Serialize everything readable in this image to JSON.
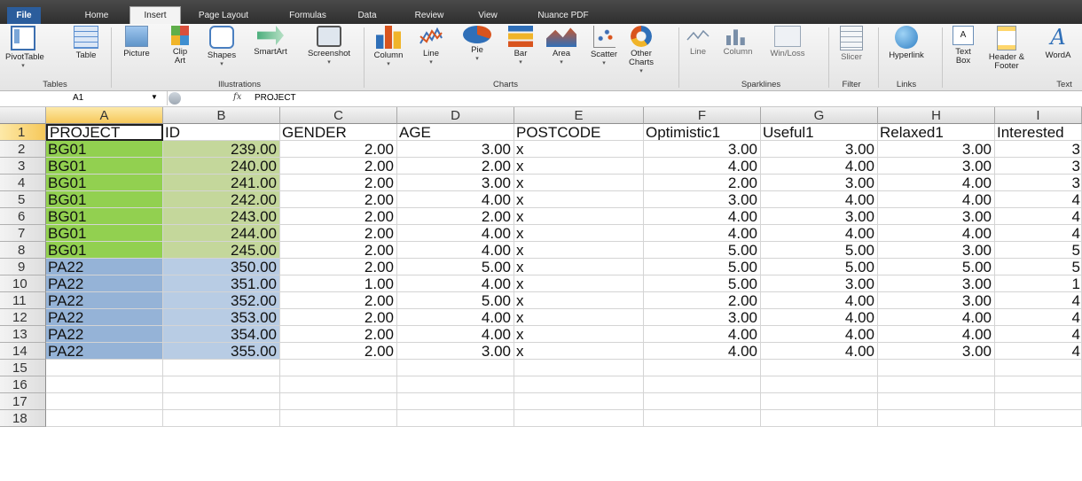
{
  "tabs": [
    "File",
    "Home",
    "Insert",
    "Page Layout",
    "Formulas",
    "Data",
    "Review",
    "View",
    "Nuance PDF"
  ],
  "active_tab": "Insert",
  "ribbon": {
    "tables": {
      "label": "Tables",
      "pivot": "PivotTable",
      "table": "Table"
    },
    "illustrations": {
      "label": "Illustrations",
      "picture": "Picture",
      "clipart": "Clip Art",
      "shapes": "Shapes",
      "smartart": "SmartArt",
      "screenshot": "Screenshot"
    },
    "charts": {
      "label": "Charts",
      "column": "Column",
      "line": "Line",
      "pie": "Pie",
      "bar": "Bar",
      "area": "Area",
      "scatter": "Scatter",
      "other": "Other Charts"
    },
    "sparklines": {
      "label": "Sparklines",
      "line": "Line",
      "column": "Column",
      "winloss": "Win/Loss"
    },
    "filter": {
      "label": "Filter",
      "slicer": "Slicer"
    },
    "links": {
      "label": "Links",
      "hyperlink": "Hyperlink"
    },
    "text": {
      "label": "Text",
      "textbox": "Text Box",
      "header": "Header & Footer",
      "wordart": "WordA"
    }
  },
  "formula_bar": {
    "name_box": "A1",
    "fx": "fx",
    "content": "PROJECT"
  },
  "columns": [
    "A",
    "B",
    "C",
    "D",
    "E",
    "F",
    "G",
    "H",
    "I"
  ],
  "rows": [
    [
      "PROJECT",
      "ID",
      "GENDER",
      "AGE",
      "POSTCODE",
      "Optimistic1",
      "Useful1",
      "Relaxed1",
      "Interested"
    ],
    [
      "BG01",
      "239.00",
      "2.00",
      "3.00",
      "x",
      "3.00",
      "3.00",
      "3.00",
      "3"
    ],
    [
      "BG01",
      "240.00",
      "2.00",
      "2.00",
      "x",
      "4.00",
      "4.00",
      "3.00",
      "3"
    ],
    [
      "BG01",
      "241.00",
      "2.00",
      "3.00",
      "x",
      "2.00",
      "3.00",
      "4.00",
      "3"
    ],
    [
      "BG01",
      "242.00",
      "2.00",
      "4.00",
      "x",
      "3.00",
      "4.00",
      "4.00",
      "4"
    ],
    [
      "BG01",
      "243.00",
      "2.00",
      "2.00",
      "x",
      "4.00",
      "3.00",
      "3.00",
      "4"
    ],
    [
      "BG01",
      "244.00",
      "2.00",
      "4.00",
      "x",
      "4.00",
      "4.00",
      "4.00",
      "4"
    ],
    [
      "BG01",
      "245.00",
      "2.00",
      "4.00",
      "x",
      "5.00",
      "5.00",
      "3.00",
      "5"
    ],
    [
      "PA22",
      "350.00",
      "2.00",
      "5.00",
      "x",
      "5.00",
      "5.00",
      "5.00",
      "5"
    ],
    [
      "PA22",
      "351.00",
      "1.00",
      "4.00",
      "x",
      "5.00",
      "3.00",
      "3.00",
      "1"
    ],
    [
      "PA22",
      "352.00",
      "2.00",
      "5.00",
      "x",
      "2.00",
      "4.00",
      "3.00",
      "4"
    ],
    [
      "PA22",
      "353.00",
      "2.00",
      "4.00",
      "x",
      "3.00",
      "4.00",
      "4.00",
      "4"
    ],
    [
      "PA22",
      "354.00",
      "2.00",
      "4.00",
      "x",
      "4.00",
      "4.00",
      "4.00",
      "4"
    ],
    [
      "PA22",
      "355.00",
      "2.00",
      "3.00",
      "x",
      "4.00",
      "4.00",
      "3.00",
      "4"
    ]
  ],
  "row_numbers": [
    "1",
    "2",
    "3",
    "4",
    "5",
    "6",
    "7",
    "8",
    "9",
    "10",
    "11",
    "12",
    "13",
    "14",
    "15",
    "16",
    "17",
    "18"
  ],
  "colors": {
    "green_a": "#92d050",
    "green_b": "#c4d79b",
    "blue_a": "#95b3d7",
    "blue_b": "#b8cce4"
  }
}
